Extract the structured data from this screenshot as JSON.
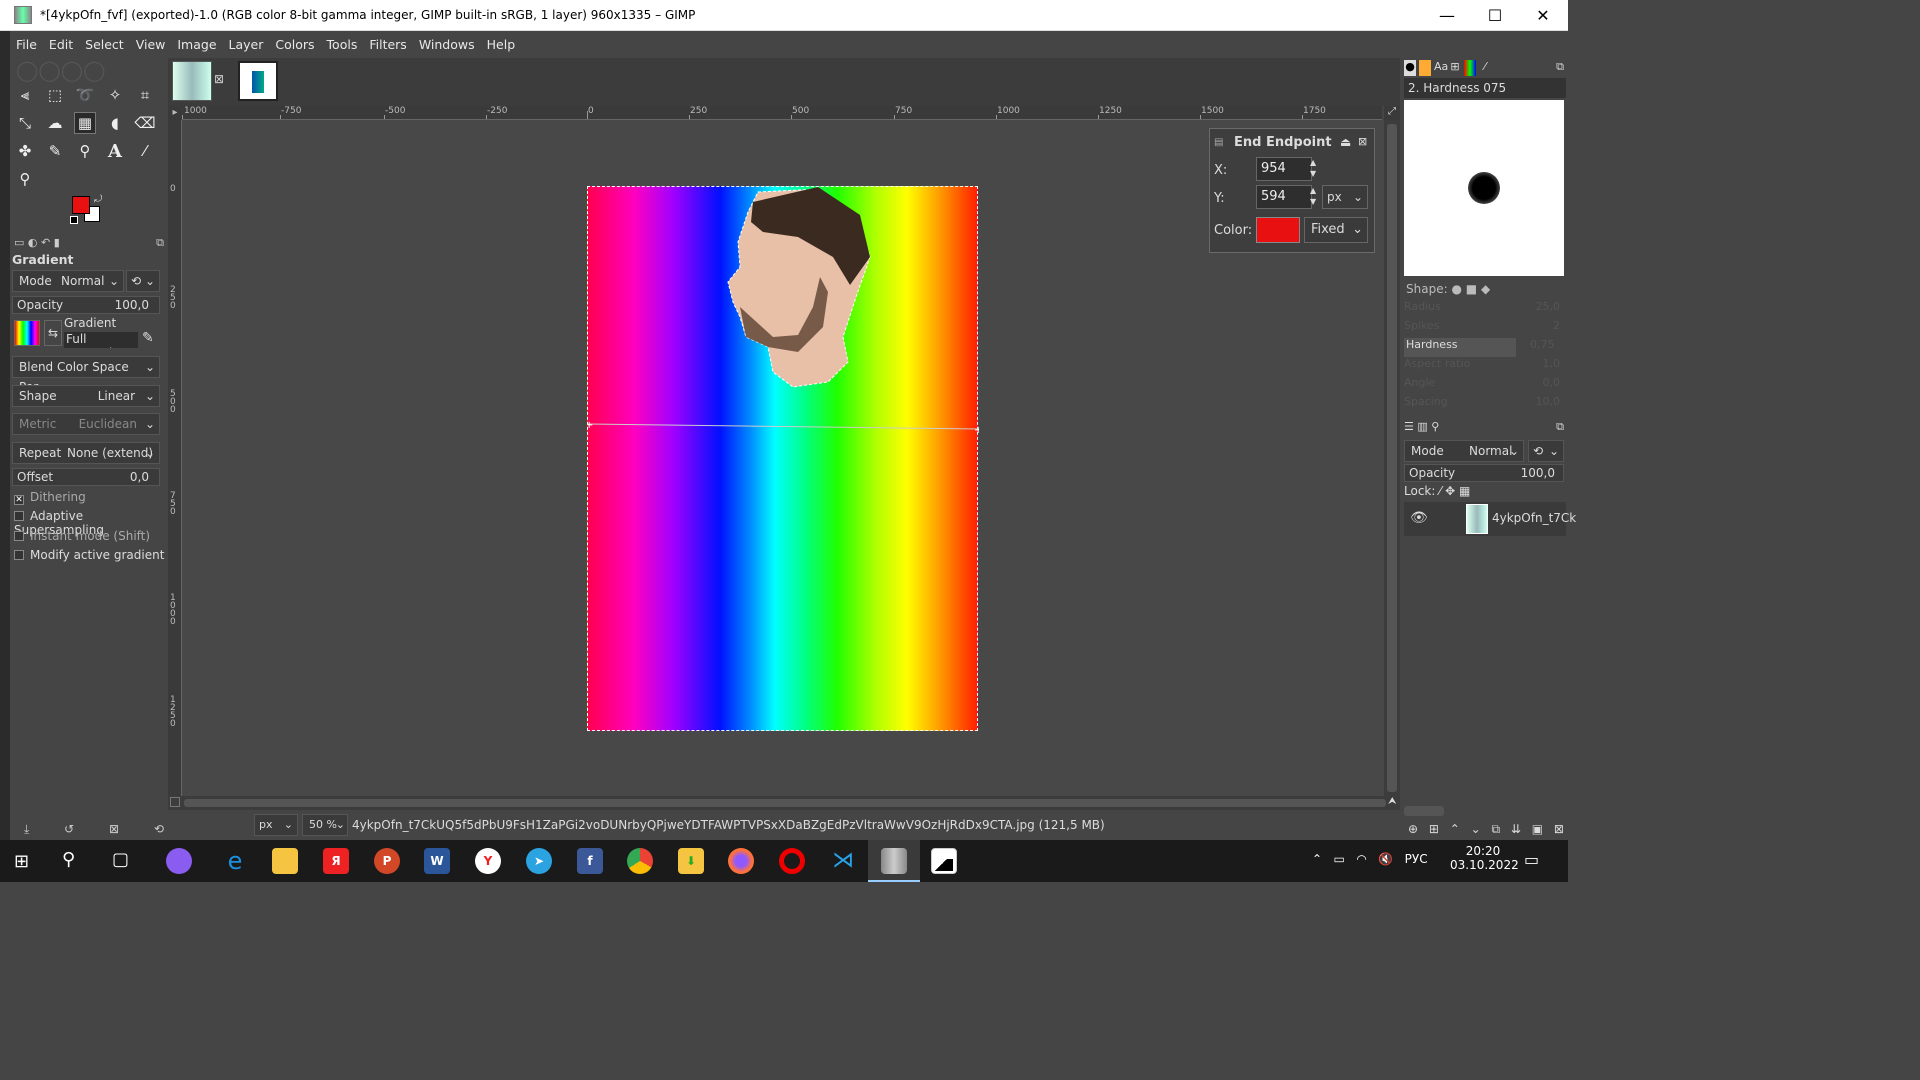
{
  "window": {
    "title": "*[4ykpOfn_fvf] (exported)-1.0 (RGB color 8-bit gamma integer, GIMP built-in sRGB, 1 layer) 960x1335 – GIMP",
    "minimize": "—",
    "maximize": "☐",
    "close": "✕"
  },
  "menu": [
    "File",
    "Edit",
    "Select",
    "View",
    "Image",
    "Layer",
    "Colors",
    "Tools",
    "Filters",
    "Windows",
    "Help"
  ],
  "colors": {
    "foreground": "#e81010",
    "background": "#ffffff"
  },
  "tool_options": {
    "title": "Gradient",
    "mode_label": "Mode",
    "mode_value": "Normal",
    "opacity_label": "Opacity",
    "opacity_value": "100,0",
    "gradient_label": "Gradient",
    "gradient_name": "Full saturatio",
    "blend_space": "Blend Color Space Per...",
    "shape_label": "Shape",
    "shape_value": "Linear",
    "metric_label": "Metric",
    "metric_value": "Euclidean",
    "repeat_label": "Repeat",
    "repeat_value": "None (extend)",
    "offset_label": "Offset",
    "offset_value": "0,0",
    "dithering": "Dithering",
    "adaptive": "Adaptive Supersampling",
    "instant": "Instant mode  (Shift)",
    "modify": "Modify active gradient"
  },
  "ruler_top": [
    "1000",
    "-750",
    "-500",
    "-250",
    "0",
    "250",
    "500",
    "750",
    "1000",
    "1250",
    "1500",
    "1750"
  ],
  "ruler_left": [
    "0",
    "250",
    "500",
    "750",
    "1000",
    "1250"
  ],
  "endpoint": {
    "title": "End Endpoint",
    "x_label": "X:",
    "x_value": "954",
    "y_label": "Y:",
    "y_value": "594",
    "unit": "px",
    "color_label": "Color:",
    "color_value": "#e81010",
    "color_mode": "Fixed"
  },
  "brushes": {
    "name": "2. Hardness 075",
    "shape_label": "Shape:",
    "params": [
      {
        "label": "Radius",
        "value": "25,0"
      },
      {
        "label": "Spikes",
        "value": "2"
      },
      {
        "label": "Hardness",
        "value": "0,75"
      },
      {
        "label": "Aspect ratio",
        "value": "1,0"
      },
      {
        "label": "Angle",
        "value": "0,0"
      },
      {
        "label": "Spacing",
        "value": "10,0"
      }
    ]
  },
  "layers": {
    "mode_label": "Mode",
    "mode_value": "Normal",
    "opacity_label": "Opacity",
    "opacity_value": "100,0",
    "lock_label": "Lock:",
    "layer_name": "4ykpOfn_t7Ck"
  },
  "status": {
    "unit": "px",
    "zoom": "50 %",
    "message": "4ykpOfn_t7CkUQ5f5dPbU9FsH1ZaPGi2voDUNrbyQPjweYDTFAWPTVPSxXDaBZgEdPzVltraWwV9OzHjRdDx9CTA.jpg (121,5 MB)"
  },
  "taskbar": {
    "lang": "РУС",
    "time": "20:20",
    "date": "03.10.2022",
    "apps": [
      "start",
      "search",
      "task-view",
      "app-purple",
      "edge",
      "explorer",
      "yandex-music",
      "powerpoint",
      "word",
      "yandex-browser",
      "telegram",
      "facebook",
      "chrome",
      "download-folder",
      "firefox",
      "opera",
      "vscode",
      "gimp",
      "photos"
    ]
  }
}
